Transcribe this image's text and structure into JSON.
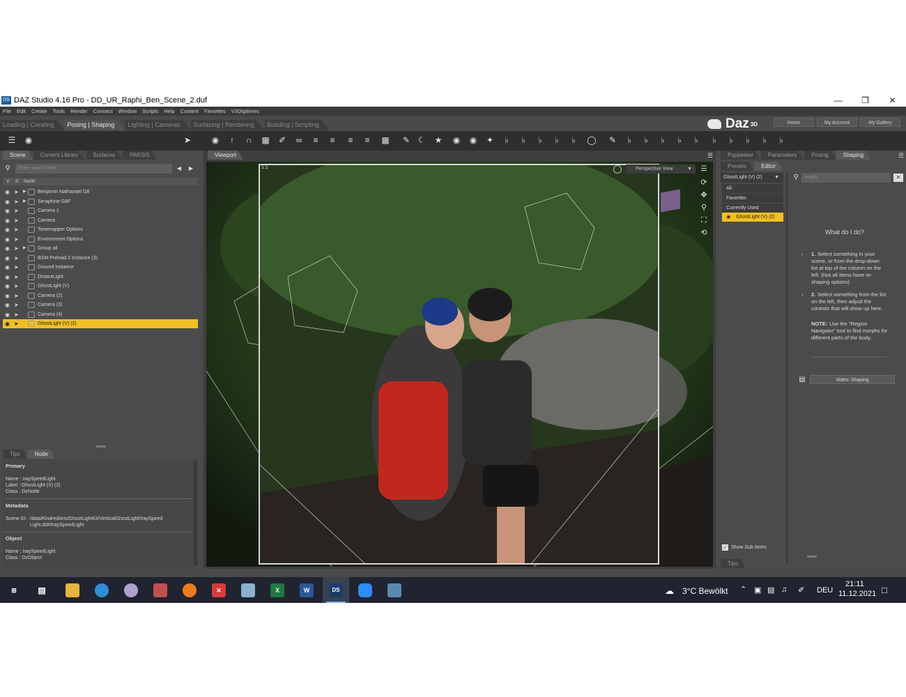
{
  "window": {
    "app_icon": "DS",
    "title": "DAZ Studio 4.16 Pro - DD_UR_Raphi_Ben_Scene_2.duf",
    "controls": [
      "minimize",
      "restore",
      "close"
    ]
  },
  "menu": [
    "File",
    "Edit",
    "Create",
    "Tools",
    "Render",
    "Connect",
    "Window",
    "Scripts",
    "Help",
    "Content",
    "Favorites",
    "V3Digitimes"
  ],
  "layout_tabs": {
    "items": [
      "Loading | Creating",
      "Posing | Shaping",
      "Lighting | Cameras",
      "Surfacing | Rendering",
      "Building | Scripting"
    ],
    "active": "Posing | Shaping"
  },
  "brand": {
    "name": "Daz",
    "superscript": "3D"
  },
  "top_buttons": [
    "Home",
    "My Account",
    "My Gallery"
  ],
  "left_panel": {
    "tabs": [
      "Scene",
      "Content Library",
      "Surfaces",
      "PARSIS"
    ],
    "active_tab": "Scene",
    "search_placeholder": "Enter search filter",
    "columns": {
      "v": "V",
      "s": "S",
      "node": "Node"
    },
    "nodes": [
      {
        "label": "Benjamin Nathanael G8",
        "expandable": true,
        "selected": false
      },
      {
        "label": "Seraphine G8F",
        "expandable": true,
        "selected": false
      },
      {
        "label": "Camera 1",
        "expandable": false,
        "selected": false
      },
      {
        "label": "Camera",
        "expandable": false,
        "selected": false
      },
      {
        "label": "Tonemapper Options",
        "expandable": false,
        "selected": false
      },
      {
        "label": "Environment Options",
        "expandable": false,
        "selected": false
      },
      {
        "label": "Group all",
        "expandable": true,
        "selected": false
      },
      {
        "label": "BSM Preload 2 Instance (3)",
        "expandable": false,
        "selected": false
      },
      {
        "label": "Ground Instance",
        "expandable": false,
        "selected": false
      },
      {
        "label": "DistantLight",
        "expandable": false,
        "selected": false
      },
      {
        "label": "GhostLight (V)",
        "expandable": false,
        "selected": false
      },
      {
        "label": "Camera (2)",
        "expandable": false,
        "selected": false
      },
      {
        "label": "Camera (3)",
        "expandable": false,
        "selected": false
      },
      {
        "label": "Camera (4)",
        "expandable": false,
        "selected": false
      },
      {
        "label": "GhostLight (V) (2)",
        "expandable": false,
        "selected": true
      }
    ],
    "info_tabs": [
      "Tips",
      "Node"
    ],
    "info_active_tab": "Node",
    "info": {
      "primary_heading": "Primary",
      "name_line": "Name : IraySpeedLight",
      "label_line": "Label : GhostLight (V) (2)",
      "class_line": "Class : DzNode",
      "metadata_heading": "Metadata",
      "scene_id_line1": "Scene ID : /data/KindredArts/GhostLightKit/VerticalGhostLight/IraySpeed",
      "scene_id_line2": "Light.dsf#IraySpeedLight",
      "object_heading": "Object",
      "obj_name_line": "Name : IraySpeedLight",
      "obj_class_line": "Class : DzObject"
    }
  },
  "viewport": {
    "tab": "Viewport",
    "view_mode": "Perspective View",
    "frame_label": "1:1"
  },
  "right_panel": {
    "tabs": [
      "Puppeteer",
      "Parameters",
      "Posing",
      "Shaping"
    ],
    "active_tab": "Shaping",
    "subtabs": [
      "Presets",
      "Editor"
    ],
    "active_subtab": "Editor",
    "node_dropdown": "GhostLight (V) (2)",
    "filter_placeholder": "length",
    "list": [
      "All",
      "Favorites",
      "Currently Used",
      "GhostLight (V) (2)"
    ],
    "selected_list_item": "GhostLight (V) (2)",
    "help_title": "What do I do?",
    "step1_num": "1.",
    "step1_lines": [
      "Select something in your",
      "scene, or from the drop-down",
      "list at top of the column on the",
      "left. (Not all items have re-",
      "shaping options)"
    ],
    "step2_num": "2.",
    "step2_lines": [
      "Select something from the list",
      "on the left, then adjust the",
      "controls that will show up here."
    ],
    "note_label": "NOTE:",
    "note_lines": [
      "Use the \"Region",
      "Navigator\" tool to find morphs for",
      "different parts of the body."
    ],
    "video_button": "Video: Shaping",
    "show_sub_items": "Show Sub Items",
    "bottom_tab": "Tips"
  },
  "taskbar": {
    "weather": "3°C  Bewölkt",
    "language": "DEU",
    "time": "21:11",
    "date": "11.12.2021",
    "pinned": [
      "start",
      "task-view",
      "file-explorer",
      "edge",
      "app-paint",
      "app-pen",
      "firefox",
      "app-x",
      "app-notes",
      "excel",
      "word",
      "daz-studio",
      "zoom",
      "app-window"
    ]
  },
  "colors": {
    "accent_selection": "#f2c01e",
    "panel_bg": "#4b4b4b",
    "taskbar_bg": "#1f2430"
  }
}
